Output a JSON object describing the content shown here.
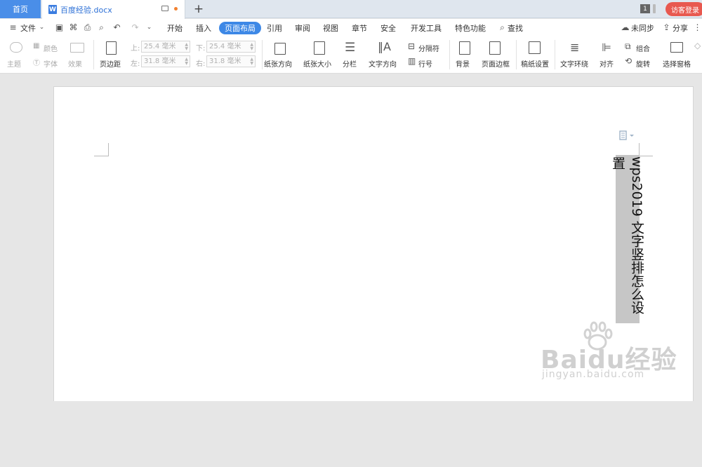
{
  "tabs": {
    "home": "首页",
    "document": "百度经验.docx",
    "new_tab": "+",
    "window_count": "1",
    "visitor_login": "访客登录"
  },
  "menu": {
    "file": "文件",
    "items": [
      "开始",
      "插入",
      "页面布局",
      "引用",
      "审阅",
      "视图",
      "章节",
      "安全",
      "开发工具",
      "特色功能"
    ],
    "active": "页面布局",
    "search": "查找",
    "sync": "未同步",
    "share": "分享"
  },
  "ribbon": {
    "theme": "主题",
    "color": "颜色",
    "font": "字体",
    "effect": "效果",
    "margins": "页边距",
    "top_label": "上:",
    "bottom_label": "下:",
    "left_label": "左:",
    "right_label": "右:",
    "top_value": "25.4 毫米",
    "bottom_value": "25.4 毫米",
    "left_value": "31.8 毫米",
    "right_value": "31.8 毫米",
    "orientation": "纸张方向",
    "paper_size": "纸张大小",
    "columns": "分栏",
    "text_direction": "文字方向",
    "breaks": "分隔符",
    "line_numbers": "行号",
    "background": "背景",
    "page_border": "页面边框",
    "draft_settings": "稿纸设置",
    "text_wrap": "文字环绕",
    "align": "对齐",
    "group": "组合",
    "rotate": "旋转",
    "selection_pane": "选择窗格"
  },
  "document": {
    "vertical_text": "wps2019 文字竖排怎么设置"
  },
  "watermark": {
    "brand": "Baidu经验",
    "url": "jingyan.baidu.com"
  }
}
